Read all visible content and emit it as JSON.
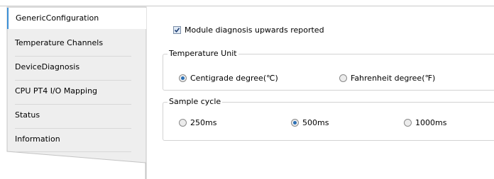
{
  "nav": {
    "items": [
      {
        "label": "GenericConfiguration",
        "selected": true
      },
      {
        "label": "Temperature Channels",
        "selected": false
      },
      {
        "label": "DeviceDiagnosis",
        "selected": false
      },
      {
        "label": "CPU PT4 I/O Mapping",
        "selected": false
      },
      {
        "label": "Status",
        "selected": false
      },
      {
        "label": "Information",
        "selected": false
      }
    ]
  },
  "settings": {
    "module_diagnosis": {
      "label": "Module diagnosis upwards reported",
      "checked": true
    },
    "temperature_unit": {
      "title": "Temperature Unit",
      "options": [
        {
          "label": "Centigrade degree(℃)",
          "selected": true
        },
        {
          "label": "Fahrenheit degree(℉)",
          "selected": false
        }
      ]
    },
    "sample_cycle": {
      "title": "Sample cycle",
      "options": [
        {
          "label": "250ms",
          "selected": false
        },
        {
          "label": "500ms",
          "selected": true
        },
        {
          "label": "1000ms",
          "selected": false
        }
      ]
    }
  },
  "colors": {
    "accent": "#3c8fd6",
    "nav_background": "#eeeeee",
    "radio_dot": "#2b6fb4"
  }
}
